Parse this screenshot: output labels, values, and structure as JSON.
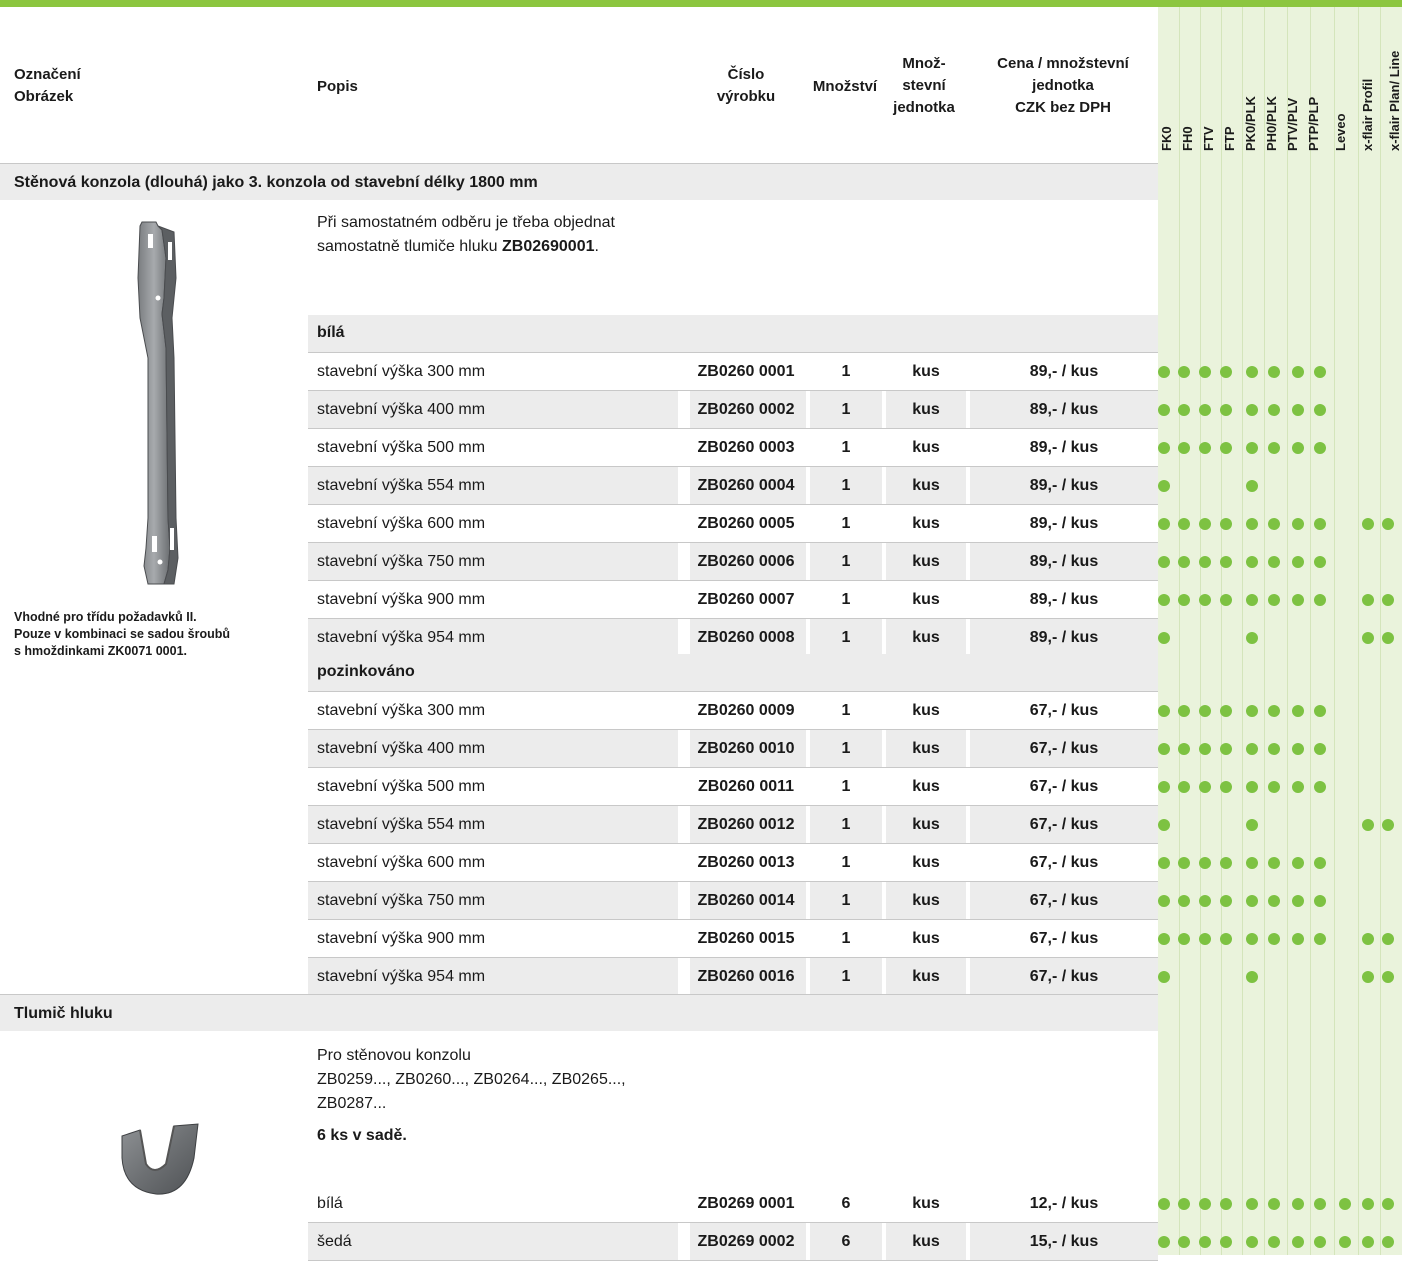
{
  "header": {
    "col1": [
      "Označení",
      "Obrázek"
    ],
    "col2": "Popis",
    "col3": [
      "Číslo",
      "výrobku"
    ],
    "col4": "Množství",
    "col5": [
      "Množ-",
      "stevní",
      "jednotka"
    ],
    "col6": [
      "Cena / množstevní",
      "jednotka",
      "CZK bez DPH"
    ],
    "compat": [
      "FK0",
      "FH0",
      "FTV",
      "FTP",
      "PK0/PLK",
      "PH0/PLK",
      "PTV/PLV",
      "PTP/PLP",
      "Leveo",
      "x-flair Profil",
      "x-flair Plan/ Line"
    ]
  },
  "sections": [
    {
      "title": "Stěnová konzola (dlouhá) jako 3. konzola od stavební délky 1800 mm",
      "description": [
        "Při samostatném odběru je třeba objednat",
        "samostatně tlumiče hluku ",
        "ZB02690001",
        "."
      ],
      "note": [
        "Vhodné pro třídu požadavků II.",
        "Pouze v kombinaci se sadou šroubů",
        "s hmoždinkami ZK0071 0001."
      ],
      "groups": [
        {
          "name": "bílá",
          "rows": [
            {
              "desc": "stavební výška 300 mm",
              "num": "ZB0260 0001",
              "qty": "1",
              "unit": "kus",
              "price": "89,- / kus",
              "dots": [
                1,
                1,
                1,
                1,
                1,
                1,
                1,
                1,
                0,
                0,
                0
              ]
            },
            {
              "desc": "stavební výška 400 mm",
              "num": "ZB0260 0002",
              "qty": "1",
              "unit": "kus",
              "price": "89,- / kus",
              "dots": [
                1,
                1,
                1,
                1,
                1,
                1,
                1,
                1,
                0,
                0,
                0
              ]
            },
            {
              "desc": "stavební výška 500 mm",
              "num": "ZB0260 0003",
              "qty": "1",
              "unit": "kus",
              "price": "89,- / kus",
              "dots": [
                1,
                1,
                1,
                1,
                1,
                1,
                1,
                1,
                0,
                0,
                0
              ]
            },
            {
              "desc": "stavební výška 554 mm",
              "num": "ZB0260 0004",
              "qty": "1",
              "unit": "kus",
              "price": "89,- / kus",
              "dots": [
                1,
                0,
                0,
                0,
                1,
                0,
                0,
                0,
                0,
                0,
                0
              ]
            },
            {
              "desc": "stavební výška 600 mm",
              "num": "ZB0260 0005",
              "qty": "1",
              "unit": "kus",
              "price": "89,- / kus",
              "dots": [
                1,
                1,
                1,
                1,
                1,
                1,
                1,
                1,
                0,
                1,
                1
              ]
            },
            {
              "desc": "stavební výška 750 mm",
              "num": "ZB0260 0006",
              "qty": "1",
              "unit": "kus",
              "price": "89,- / kus",
              "dots": [
                1,
                1,
                1,
                1,
                1,
                1,
                1,
                1,
                0,
                0,
                0
              ]
            },
            {
              "desc": "stavební výška 900 mm",
              "num": "ZB0260 0007",
              "qty": "1",
              "unit": "kus",
              "price": "89,- / kus",
              "dots": [
                1,
                1,
                1,
                1,
                1,
                1,
                1,
                1,
                0,
                1,
                1
              ]
            },
            {
              "desc": "stavební výška 954 mm",
              "num": "ZB0260 0008",
              "qty": "1",
              "unit": "kus",
              "price": "89,- / kus",
              "dots": [
                1,
                0,
                0,
                0,
                1,
                0,
                0,
                0,
                0,
                1,
                1
              ]
            }
          ]
        },
        {
          "name": "pozinkováno",
          "rows": [
            {
              "desc": "stavební výška 300 mm",
              "num": "ZB0260 0009",
              "qty": "1",
              "unit": "kus",
              "price": "67,- / kus",
              "dots": [
                1,
                1,
                1,
                1,
                1,
                1,
                1,
                1,
                0,
                0,
                0
              ]
            },
            {
              "desc": "stavební výška 400 mm",
              "num": "ZB0260 0010",
              "qty": "1",
              "unit": "kus",
              "price": "67,- / kus",
              "dots": [
                1,
                1,
                1,
                1,
                1,
                1,
                1,
                1,
                0,
                0,
                0
              ]
            },
            {
              "desc": "stavební výška 500 mm",
              "num": "ZB0260 0011",
              "qty": "1",
              "unit": "kus",
              "price": "67,- / kus",
              "dots": [
                1,
                1,
                1,
                1,
                1,
                1,
                1,
                1,
                0,
                0,
                0
              ]
            },
            {
              "desc": "stavební výška 554 mm",
              "num": "ZB0260 0012",
              "qty": "1",
              "unit": "kus",
              "price": "67,- / kus",
              "dots": [
                1,
                0,
                0,
                0,
                1,
                0,
                0,
                0,
                0,
                1,
                1
              ]
            },
            {
              "desc": "stavební výška 600 mm",
              "num": "ZB0260 0013",
              "qty": "1",
              "unit": "kus",
              "price": "67,- / kus",
              "dots": [
                1,
                1,
                1,
                1,
                1,
                1,
                1,
                1,
                0,
                0,
                0
              ]
            },
            {
              "desc": "stavební výška 750 mm",
              "num": "ZB0260 0014",
              "qty": "1",
              "unit": "kus",
              "price": "67,- / kus",
              "dots": [
                1,
                1,
                1,
                1,
                1,
                1,
                1,
                1,
                0,
                0,
                0
              ]
            },
            {
              "desc": "stavební výška 900 mm",
              "num": "ZB0260 0015",
              "qty": "1",
              "unit": "kus",
              "price": "67,- / kus",
              "dots": [
                1,
                1,
                1,
                1,
                1,
                1,
                1,
                1,
                0,
                1,
                1
              ]
            },
            {
              "desc": "stavební výška 954 mm",
              "num": "ZB0260 0016",
              "qty": "1",
              "unit": "kus",
              "price": "67,- / kus",
              "dots": [
                1,
                0,
                0,
                0,
                1,
                0,
                0,
                0,
                0,
                1,
                1
              ]
            }
          ]
        }
      ]
    },
    {
      "title": "Tlumič hluku",
      "description": [
        "Pro stěnovou konzolu",
        "ZB0259..., ZB0260..., ZB0264..., ZB0265...,",
        "ZB0287...",
        "6 ks v sadě."
      ],
      "rows": [
        {
          "desc": "bílá",
          "num": "ZB0269 0001",
          "qty": "6",
          "unit": "kus",
          "price": "12,- / kus",
          "dots": [
            1,
            1,
            1,
            1,
            1,
            1,
            1,
            1,
            1,
            1,
            1
          ]
        },
        {
          "desc": "šedá",
          "num": "ZB0269 0002",
          "qty": "6",
          "unit": "kus",
          "price": "15,- / kus",
          "dots": [
            1,
            1,
            1,
            1,
            1,
            1,
            1,
            1,
            1,
            1,
            1
          ]
        }
      ]
    }
  ],
  "colors": {
    "accent": "#8cc63f",
    "dot": "#7dc242",
    "compat_bg": "#eaf3dc",
    "band": "#ececec"
  },
  "icons": [
    "wall-bracket-image",
    "noise-damper-image"
  ]
}
